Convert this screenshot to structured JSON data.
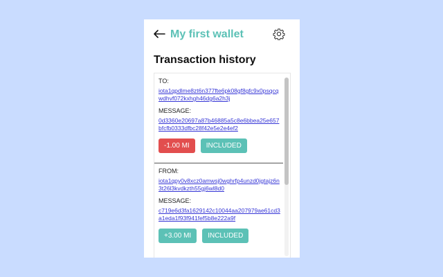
{
  "header": {
    "title": "My first wallet",
    "back_icon": "arrow-left-icon",
    "settings_icon": "gear-icon"
  },
  "section_title": "Transaction history",
  "colors": {
    "accent": "#5cc1b6",
    "negative": "#e24e4e",
    "link": "#3434d6",
    "background": "#c9dcff"
  },
  "transactions": [
    {
      "direction_label": "TO:",
      "address": "iota1qpdlme8zt6n377fte6pk08gf8gfc9x0psqcqwdhvf072kxhgh46dg6a2h3j",
      "message_label": "MESSAGE:",
      "message": "0d3360e20697a87b46885a5c8e6bbea25e657bfcfb0333dfbc28f42e5e2e4ef2",
      "amount": "-1.00 MI",
      "status": "INCLUDED"
    },
    {
      "direction_label": "FROM:",
      "address": "iota1qpy0v8xcz0amwsj0wghrfp4unzd0jgtajz6n3t26l3kvdkzth55gj6wl8d0",
      "message_label": "MESSAGE:",
      "message": "c719e6d3fa1629142c10044aa207979ae61cd3a1eda1f93f941fef5b8e222a9f",
      "amount": "+3.00 MI",
      "status": "INCLUDED"
    }
  ]
}
